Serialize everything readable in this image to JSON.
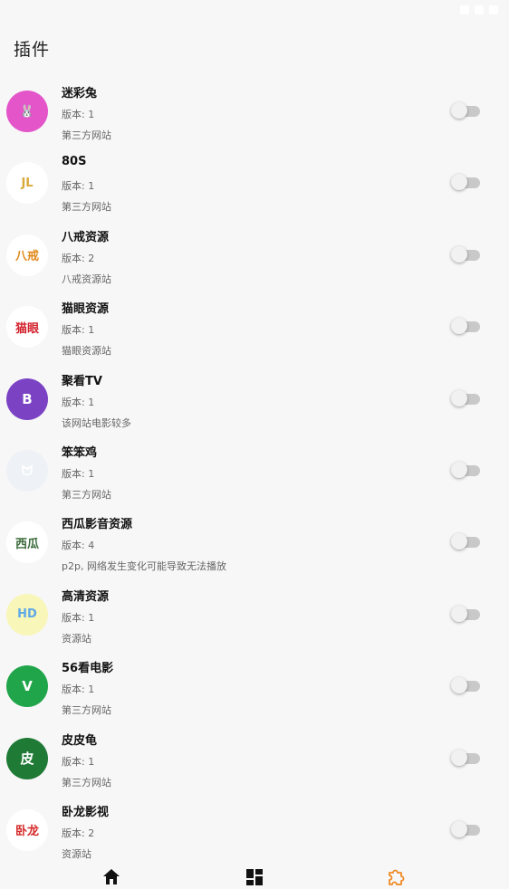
{
  "page": {
    "title": "插件"
  },
  "plugins": [
    {
      "name": "迷彩兔",
      "version": "版本: 1",
      "description": "第三方网站",
      "enabled": false,
      "icon": "rabbit-icon",
      "icon_text": "🐰",
      "icon_bg": "#e355c9",
      "icon_color": "#ffffff"
    },
    {
      "name": "80S",
      "version": "版本: 1",
      "description": "第三方网站",
      "enabled": false,
      "icon": "80s-logo-icon",
      "icon_text": "JL",
      "icon_bg": "#ffffff",
      "icon_color": "#d9a93a"
    },
    {
      "name": "八戒资源",
      "version": "版本: 2",
      "description": "八戒资源站",
      "enabled": false,
      "icon": "bajie-logo-icon",
      "icon_text": "八戒",
      "icon_bg": "#ffffff",
      "icon_color": "#e08a1c"
    },
    {
      "name": "猫眼资源",
      "version": "版本: 1",
      "description": "猫眼资源站",
      "enabled": false,
      "icon": "maoyan-logo-icon",
      "icon_text": "猫眼",
      "icon_bg": "#ffffff",
      "icon_color": "#d21f2b"
    },
    {
      "name": "聚看TV",
      "version": "版本: 1",
      "description": "该网站电影较多",
      "enabled": false,
      "icon": "jukan-tv-logo-icon",
      "icon_text": "B",
      "icon_bg": "#7b43c4",
      "icon_color": "#ffffff"
    },
    {
      "name": "笨笨鸡",
      "version": "版本: 1",
      "description": "第三方网站",
      "enabled": false,
      "icon": "benbenji-logo-icon",
      "icon_text": "ᗢ",
      "icon_bg": "#eef1f5",
      "icon_color": "#ffffff"
    },
    {
      "name": "西瓜影音资源",
      "version": "版本: 4",
      "description": "p2p, 网络发生变化可能导致无法播放",
      "enabled": false,
      "icon": "xigua-logo-icon",
      "icon_text": "西瓜",
      "icon_bg": "#ffffff",
      "icon_color": "#3b6b3b"
    },
    {
      "name": "高清资源",
      "version": "版本: 1",
      "description": "资源站",
      "enabled": false,
      "icon": "gaoqing-logo-icon",
      "icon_text": "HD",
      "icon_bg": "#f8f6b8",
      "icon_color": "#5fa8e8"
    },
    {
      "name": "56看电影",
      "version": "版本: 1",
      "description": "第三方网站",
      "enabled": false,
      "icon": "v-logo-icon",
      "icon_text": "V",
      "icon_bg": "#20a54a",
      "icon_color": "#ffffff"
    },
    {
      "name": "皮皮龟",
      "version": "版本: 1",
      "description": "第三方网站",
      "enabled": false,
      "icon": "pipigui-logo-icon",
      "icon_text": "皮",
      "icon_bg": "#1f7a36",
      "icon_color": "#ffffff"
    },
    {
      "name": "卧龙影视",
      "version": "版本: 2",
      "description": "资源站",
      "enabled": false,
      "icon": "wolong-logo-icon",
      "icon_text": "卧龙",
      "icon_bg": "#ffffff",
      "icon_color": "#d62a2a"
    }
  ],
  "bottom_nav": [
    {
      "name": "home",
      "icon": "home-icon",
      "active": false
    },
    {
      "name": "dashboard",
      "icon": "grid-icon",
      "active": false
    },
    {
      "name": "plugins",
      "icon": "puzzle-icon",
      "active": true
    }
  ],
  "colors": {
    "active_nav": "#f08a24",
    "inactive_nav": "#111111",
    "toggle_track": "#c9c9c9",
    "toggle_knob": "#f1f1f1"
  }
}
